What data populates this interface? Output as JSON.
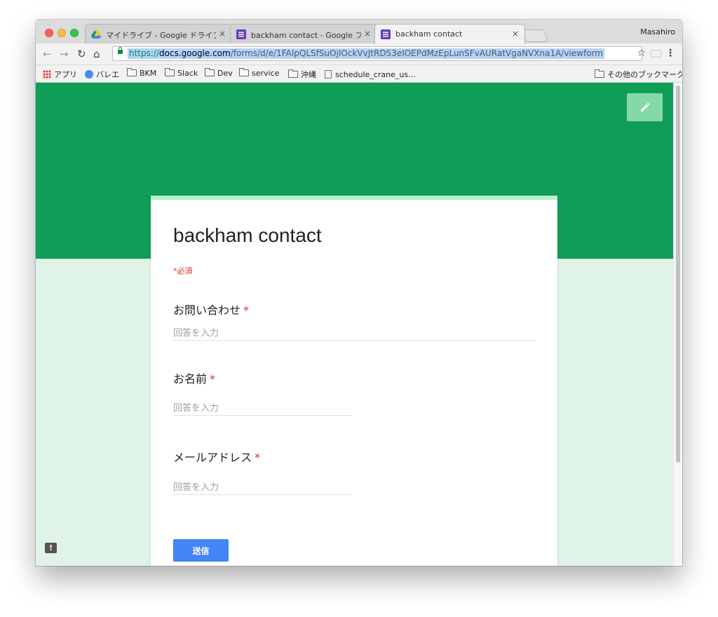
{
  "browser": {
    "profile_name": "Masahiro",
    "tabs": [
      {
        "title": "マイドライブ - Google ドライブ",
        "close": "×",
        "icon": "google-drive-icon"
      },
      {
        "title": "backham contact - Google フォ",
        "close": "×",
        "icon": "google-forms-icon"
      },
      {
        "title": "backham contact",
        "close": "×",
        "icon": "google-forms-icon"
      }
    ],
    "address_bar": {
      "scheme": "https://",
      "host": "docs.google.com",
      "path": "/forms/d/e/1FAIpQLSfSuOjIOckVvJtRDS3eIOEPdMzEpLunSFvAURatVgaNVXna1A/viewform"
    },
    "bookmarks": [
      {
        "label": "アプリ",
        "icon": "apps-grid-icon"
      },
      {
        "label": "バレエ",
        "icon": "globe-icon"
      },
      {
        "label": "BKM",
        "icon": "folder-icon"
      },
      {
        "label": "Slack",
        "icon": "folder-icon"
      },
      {
        "label": "Dev",
        "icon": "folder-icon"
      },
      {
        "label": "service",
        "icon": "folder-icon"
      },
      {
        "label": "沖縄",
        "icon": "folder-icon"
      },
      {
        "label": "schedule_crane_us...",
        "icon": "page-icon"
      }
    ],
    "other_bookmarks": "その他のブックマーク"
  },
  "form": {
    "title": "backham contact",
    "required_note": "*必須",
    "questions": [
      {
        "label": "お問い合わせ",
        "asterisk": "*",
        "placeholder": "回答を入力"
      },
      {
        "label": "お名前",
        "asterisk": "*",
        "placeholder": "回答を入力"
      },
      {
        "label": "メールアドレス",
        "asterisk": "*",
        "placeholder": "回答を入力"
      }
    ],
    "submit_label": "送信"
  },
  "colors": {
    "banner": "#0f9d58",
    "page_background": "#e0f3e7",
    "card_accent": "#b7f1c9",
    "submit": "#4285f4",
    "required": "#d93025"
  }
}
